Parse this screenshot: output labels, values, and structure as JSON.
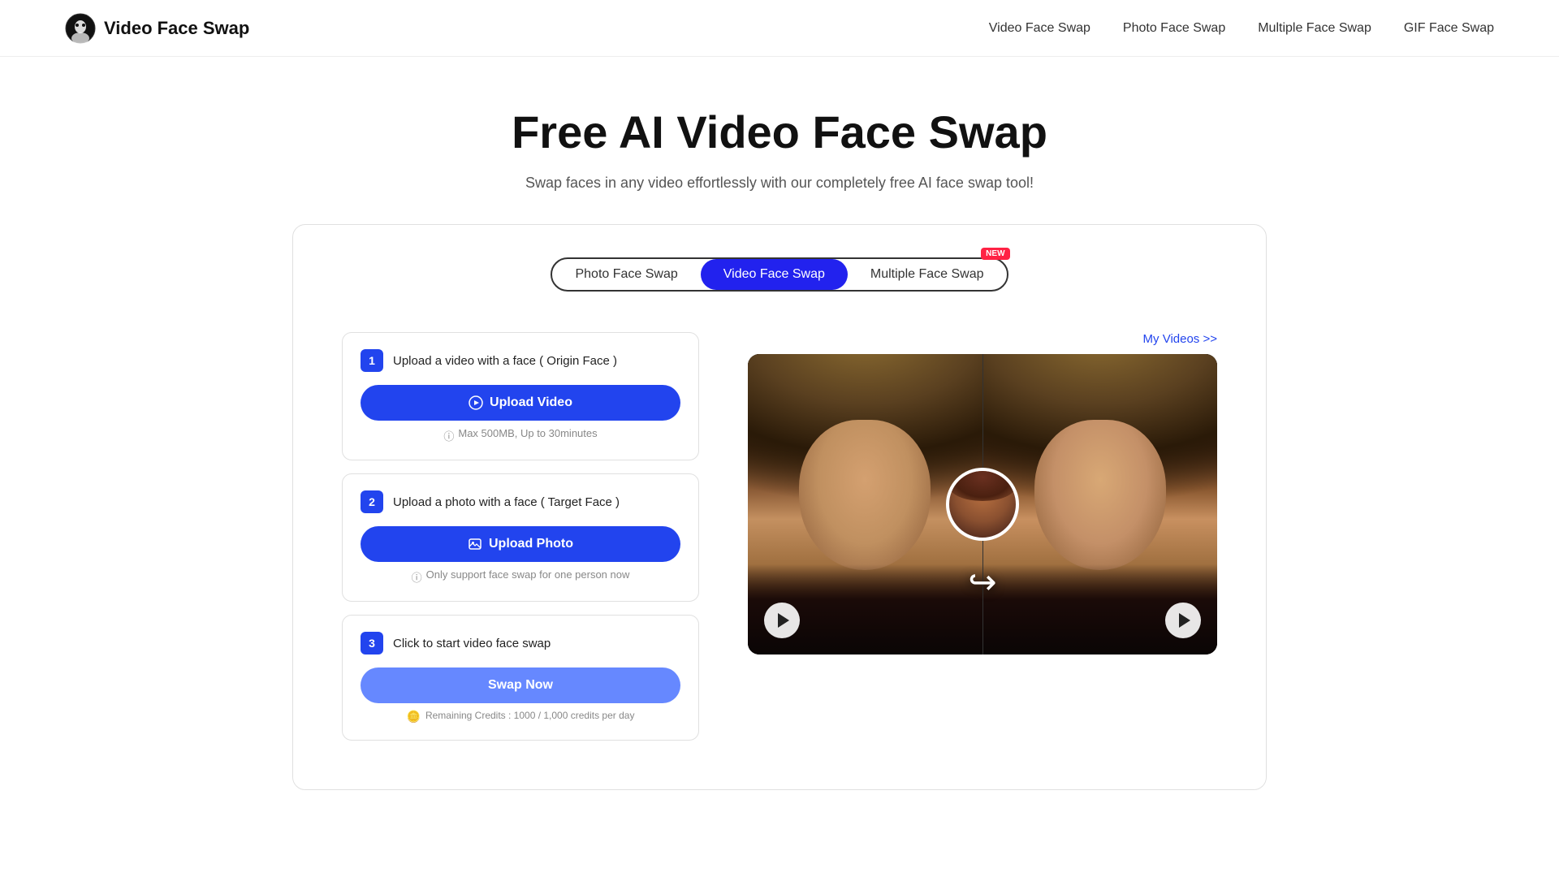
{
  "header": {
    "logo_text": "Video Face Swap",
    "nav": [
      {
        "label": "Video Face Swap",
        "active": true
      },
      {
        "label": "Photo Face Swap",
        "active": false
      },
      {
        "label": "Multiple Face Swap",
        "active": false
      },
      {
        "label": "GIF Face Swap",
        "active": false
      }
    ]
  },
  "hero": {
    "title": "Free AI Video Face Swap",
    "subtitle": "Swap faces in any video effortlessly with our completely free AI face swap tool!"
  },
  "tabs": [
    {
      "label": "Photo Face Swap",
      "active": false,
      "new": false
    },
    {
      "label": "Video Face Swap",
      "active": true,
      "new": false
    },
    {
      "label": "Multiple Face Swap",
      "active": false,
      "new": true
    }
  ],
  "my_videos_link": "My Videos >>",
  "steps": [
    {
      "num": "1",
      "label": "Upload a video with a face ( Origin Face )",
      "button": "Upload Video",
      "hint": "Max 500MB, Up to 30minutes"
    },
    {
      "num": "2",
      "label": "Upload a photo with a face ( Target Face )",
      "button": "Upload Photo",
      "hint": "Only support face swap for one person now"
    },
    {
      "num": "3",
      "label": "Click to start video face swap",
      "button": "Swap Now",
      "hint": "Remaining Credits : 1000 / 1,000 credits per day"
    }
  ],
  "new_badge": "NEW"
}
